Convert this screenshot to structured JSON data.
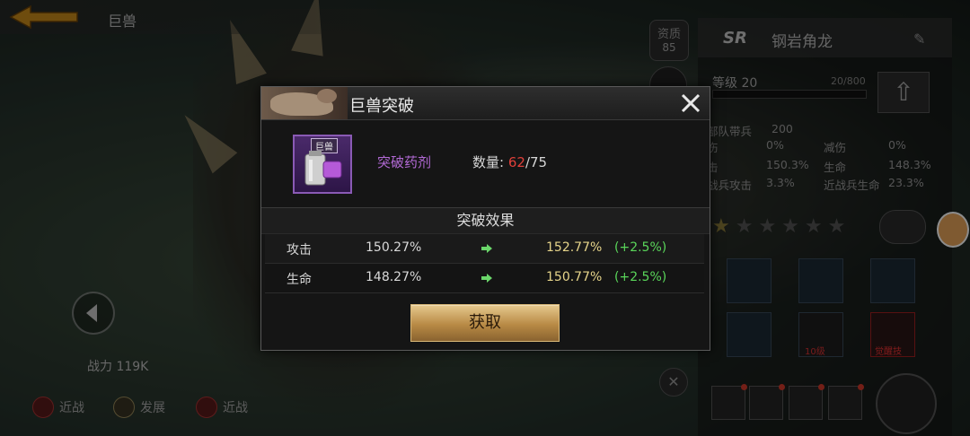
{
  "topbar": {
    "crumb": "巨兽"
  },
  "left_overlay": {
    "power": "战力 119K"
  },
  "bottom_tabs": [
    {
      "label": "近战"
    },
    {
      "label": "发展"
    },
    {
      "label": "近战"
    }
  ],
  "rank_badge": {
    "label": "资质",
    "value": "85"
  },
  "right_panel": {
    "rarity": "SR",
    "name": "钢岩角龙",
    "level": "等级 20",
    "xp": "20/800",
    "stats": [
      {
        "k": "部队带兵",
        "v": "200"
      },
      {
        "k": "伤",
        "v": "0%"
      },
      {
        "k": "减伤",
        "v": "0%"
      },
      {
        "k": "击",
        "v": "150.3%"
      },
      {
        "k": "生命",
        "v": "148.3%"
      },
      {
        "k": "战兵攻击",
        "v": "3.3%"
      },
      {
        "k": "近战兵生命",
        "v": "23.3%"
      }
    ],
    "stars_filled": 1,
    "stars_total": 6,
    "skill_labels": [
      "觉醒技"
    ],
    "lock_level": "10级"
  },
  "modal": {
    "title": "巨兽突破",
    "item_tag": "巨兽",
    "item_name": "突破药剂",
    "qty_label": "数量:",
    "qty_have": "62",
    "qty_total": "/75",
    "section_title": "突破效果",
    "rows": [
      {
        "label": "攻击",
        "before": "150.27%",
        "after": "152.77%",
        "delta": "(+2.5%)"
      },
      {
        "label": "生命",
        "before": "148.27%",
        "after": "150.77%",
        "delta": "(+2.5%)"
      }
    ],
    "get_button": "获取"
  },
  "colors": {
    "item_name": "#b36ad6",
    "qty_have": "#e0403a",
    "after": "#e6d48a",
    "delta": "#5ad65a",
    "button_gold": "#c89a55"
  }
}
